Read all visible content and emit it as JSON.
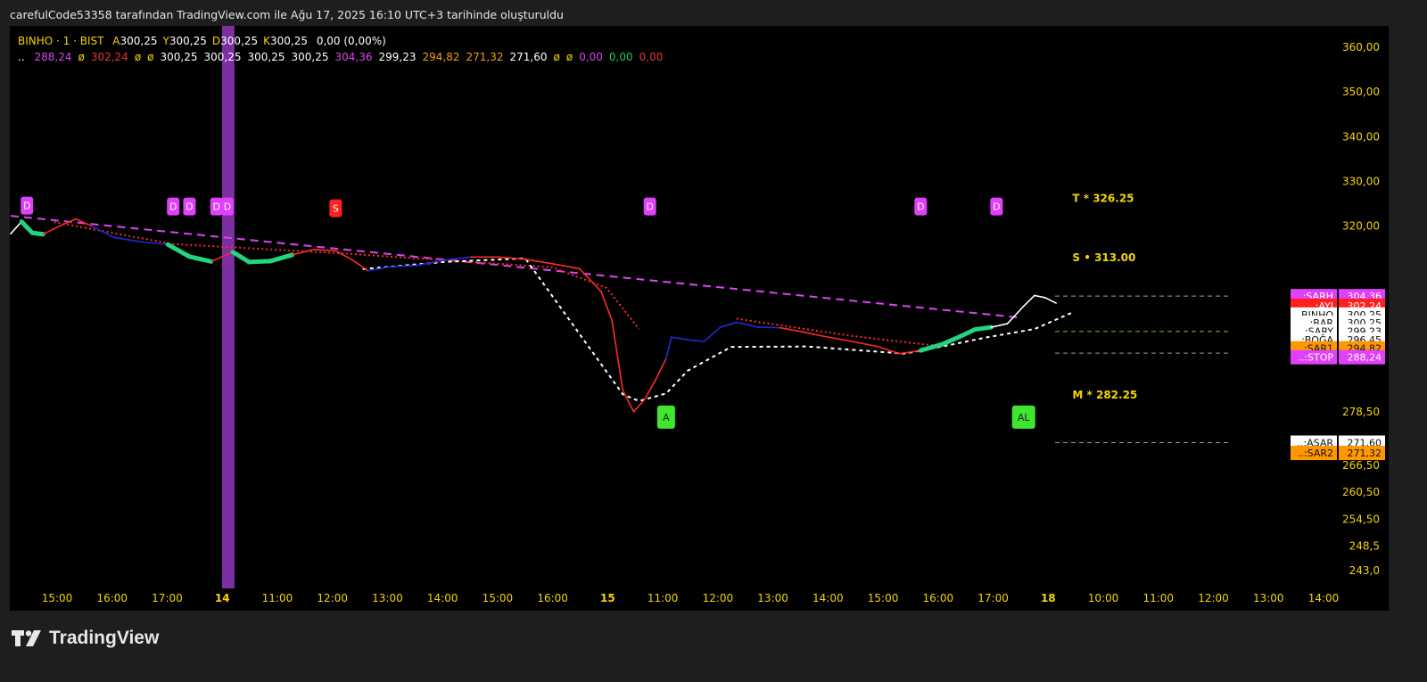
{
  "attribution": "carefulCode53358 tarafından TradingView.com ile Ağu 17, 2025 16:10 UTC+3 tarihinde oluşturuldu",
  "legend": {
    "symbol": "BINHO · 1 · BIST",
    "ohlc": [
      {
        "key": "A",
        "value": "300,25"
      },
      {
        "key": "Y",
        "value": "300,25"
      },
      {
        "key": "D",
        "value": "300,25"
      },
      {
        "key": "K",
        "value": "300,25"
      }
    ],
    "change": "0,00 (0,00%)",
    "indicator_prefix": "..",
    "indicator_values": [
      {
        "text": "288,24",
        "color": "#d946ef"
      },
      {
        "text": "ø",
        "color": "#f5d400"
      },
      {
        "text": "302,24",
        "color": "#e53935"
      },
      {
        "text": "ø",
        "color": "#f5d400"
      },
      {
        "text": "ø",
        "color": "#f5d400"
      },
      {
        "text": "300,25",
        "color": "#ffffff"
      },
      {
        "text": "300,25",
        "color": "#ffffff"
      },
      {
        "text": "300,25",
        "color": "#ffffff"
      },
      {
        "text": "300,25",
        "color": "#ffffff"
      },
      {
        "text": "304,36",
        "color": "#d946ef"
      },
      {
        "text": "299,23",
        "color": "#ffffff"
      },
      {
        "text": "294,82",
        "color": "#f59e0b"
      },
      {
        "text": "271,32",
        "color": "#f59e0b"
      },
      {
        "text": "271,60",
        "color": "#ffffff"
      },
      {
        "text": "ø",
        "color": "#f5d400"
      },
      {
        "text": "ø",
        "color": "#f5d400"
      },
      {
        "text": "0,00",
        "color": "#d946ef"
      },
      {
        "text": "0,00",
        "color": "#22c55e"
      },
      {
        "text": "0,00",
        "color": "#e53935"
      }
    ]
  },
  "footer": {
    "brand": "TradingView"
  },
  "chart_data": {
    "type": "line",
    "symbol": "BINHO",
    "timeframe": "1",
    "exchange": "BIST",
    "price_axis": {
      "ticks": [
        {
          "label": "360,00",
          "value": 360.0
        },
        {
          "label": "350,00",
          "value": 350.0
        },
        {
          "label": "340,00",
          "value": 340.0
        },
        {
          "label": "330,00",
          "value": 330.0
        },
        {
          "label": "320,00",
          "value": 320.0
        },
        {
          "label": "278,50",
          "value": 278.5
        },
        {
          "label": "266,50",
          "value": 266.5
        },
        {
          "label": "260,50",
          "value": 260.5
        },
        {
          "label": "254,50",
          "value": 254.5
        },
        {
          "label": "248,5",
          "value": 248.5
        },
        {
          "label": "243,0",
          "value": 243.0
        }
      ],
      "range": [
        239.8,
        364.9
      ]
    },
    "time_axis": {
      "labels": [
        {
          "label": "15:00",
          "bold": false
        },
        {
          "label": "16:00",
          "bold": false
        },
        {
          "label": "17:00",
          "bold": false
        },
        {
          "label": "14",
          "bold": true
        },
        {
          "label": "11:00",
          "bold": false
        },
        {
          "label": "12:00",
          "bold": false
        },
        {
          "label": "13:00",
          "bold": false
        },
        {
          "label": "14:00",
          "bold": false
        },
        {
          "label": "15:00",
          "bold": false
        },
        {
          "label": "16:00",
          "bold": false
        },
        {
          "label": "15",
          "bold": true
        },
        {
          "label": "11:00",
          "bold": false
        },
        {
          "label": "12:00",
          "bold": false
        },
        {
          "label": "13:00",
          "bold": false
        },
        {
          "label": "14:00",
          "bold": false
        },
        {
          "label": "15:00",
          "bold": false
        },
        {
          "label": "16:00",
          "bold": false
        },
        {
          "label": "17:00",
          "bold": false
        },
        {
          "label": "18",
          "bold": true
        },
        {
          "label": "10:00",
          "bold": false
        },
        {
          "label": "11:00",
          "bold": false
        },
        {
          "label": "12:00",
          "bold": false
        },
        {
          "label": "13:00",
          "bold": false
        },
        {
          "label": "14:00",
          "bold": false
        }
      ]
    },
    "price_series": [
      {
        "i": 0,
        "v": 318.3,
        "c": "white"
      },
      {
        "i": 2,
        "v": 321.0,
        "c": "white"
      },
      {
        "i": 4,
        "v": 318.5,
        "c": "green"
      },
      {
        "i": 6,
        "v": 318.2,
        "c": "green"
      },
      {
        "i": 9,
        "v": 320.0,
        "c": "red"
      },
      {
        "i": 12,
        "v": 321.6,
        "c": "red"
      },
      {
        "i": 15,
        "v": 320.0,
        "c": "red"
      },
      {
        "i": 19,
        "v": 317.5,
        "c": "blue"
      },
      {
        "i": 24,
        "v": 316.5,
        "c": "blue"
      },
      {
        "i": 29,
        "v": 315.9,
        "c": "blue"
      },
      {
        "i": 33,
        "v": 313.2,
        "c": "green"
      },
      {
        "i": 37,
        "v": 312.1,
        "c": "green"
      },
      {
        "i": 41,
        "v": 314.2,
        "c": "red"
      },
      {
        "i": 44,
        "v": 312.0,
        "c": "green"
      },
      {
        "i": 48,
        "v": 312.2,
        "c": "green"
      },
      {
        "i": 52,
        "v": 313.6,
        "c": "green"
      },
      {
        "i": 56,
        "v": 314.8,
        "c": "red"
      },
      {
        "i": 60,
        "v": 314.5,
        "c": "red"
      },
      {
        "i": 63,
        "v": 312.5,
        "c": "red"
      },
      {
        "i": 66,
        "v": 310.0,
        "c": "red"
      },
      {
        "i": 70,
        "v": 310.9,
        "c": "blue"
      },
      {
        "i": 75,
        "v": 311.2,
        "c": "blue"
      },
      {
        "i": 80,
        "v": 312.4,
        "c": "blue"
      },
      {
        "i": 85,
        "v": 313.1,
        "c": "blue"
      },
      {
        "i": 90,
        "v": 313.1,
        "c": "red"
      },
      {
        "i": 95,
        "v": 312.6,
        "c": "red"
      },
      {
        "i": 100,
        "v": 311.6,
        "c": "red"
      },
      {
        "i": 105,
        "v": 310.5,
        "c": "red"
      },
      {
        "i": 109,
        "v": 305.4,
        "c": "red"
      },
      {
        "i": 111,
        "v": 298.9,
        "c": "red"
      },
      {
        "i": 113,
        "v": 283.3,
        "c": "red"
      },
      {
        "i": 115,
        "v": 278.5,
        "c": "red"
      },
      {
        "i": 117,
        "v": 281.2,
        "c": "red"
      },
      {
        "i": 119,
        "v": 285.5,
        "c": "red"
      },
      {
        "i": 121,
        "v": 290.4,
        "c": "red"
      },
      {
        "i": 122,
        "v": 295.2,
        "c": "blue"
      },
      {
        "i": 125,
        "v": 294.6,
        "c": "blue"
      },
      {
        "i": 128,
        "v": 294.2,
        "c": "blue"
      },
      {
        "i": 131,
        "v": 297.4,
        "c": "blue"
      },
      {
        "i": 134,
        "v": 298.5,
        "c": "blue"
      },
      {
        "i": 138,
        "v": 297.4,
        "c": "blue"
      },
      {
        "i": 142,
        "v": 297.3,
        "c": "blue"
      },
      {
        "i": 146,
        "v": 296.4,
        "c": "red"
      },
      {
        "i": 150,
        "v": 295.4,
        "c": "red"
      },
      {
        "i": 155,
        "v": 294.3,
        "c": "red"
      },
      {
        "i": 160,
        "v": 293.1,
        "c": "red"
      },
      {
        "i": 164,
        "v": 291.5,
        "c": "red"
      },
      {
        "i": 168,
        "v": 292.2,
        "c": "red"
      },
      {
        "i": 172,
        "v": 293.6,
        "c": "green"
      },
      {
        "i": 175,
        "v": 295.2,
        "c": "green"
      },
      {
        "i": 178,
        "v": 296.9,
        "c": "green"
      },
      {
        "i": 181,
        "v": 297.4,
        "c": "green"
      },
      {
        "i": 184,
        "v": 298.2,
        "c": "white"
      },
      {
        "i": 187,
        "v": 302.1,
        "c": "white"
      },
      {
        "i": 189,
        "v": 304.5,
        "c": "white"
      },
      {
        "i": 191,
        "v": 304.0,
        "c": "white"
      },
      {
        "i": 193,
        "v": 302.8,
        "c": "white"
      }
    ],
    "index_span": [
      0,
      245
    ],
    "purple_trend_line": {
      "from": {
        "i": 0,
        "v": 322.3
      },
      "to": {
        "i": 186,
        "v": 299.6
      },
      "color": "#d946ef",
      "dashed": true
    },
    "red_dotted_line": [
      {
        "i": 8,
        "v": 320.9
      },
      {
        "i": 30,
        "v": 316.0
      },
      {
        "i": 60,
        "v": 314.0
      },
      {
        "i": 85,
        "v": 312.0
      },
      {
        "i": 100,
        "v": 310.8
      },
      {
        "i": 110,
        "v": 306.2
      },
      {
        "i": 116,
        "v": 297.0
      }
    ],
    "red_dotted_line_2": [
      {
        "i": 134,
        "v": 299.3
      },
      {
        "i": 155,
        "v": 295.5
      },
      {
        "i": 172,
        "v": 293.1
      }
    ],
    "white_dashed_line": [
      {
        "i": 65,
        "v": 310.4
      },
      {
        "i": 80,
        "v": 312.0
      },
      {
        "i": 95,
        "v": 312.8
      },
      {
        "i": 113,
        "v": 282.4
      },
      {
        "i": 116,
        "v": 280.9
      },
      {
        "i": 121,
        "v": 282.6
      },
      {
        "i": 125,
        "v": 287.7
      },
      {
        "i": 133,
        "v": 293.0
      },
      {
        "i": 147,
        "v": 293.1
      },
      {
        "i": 165,
        "v": 291.5
      },
      {
        "i": 172,
        "v": 293.1
      },
      {
        "i": 180,
        "v": 295.1
      },
      {
        "i": 189,
        "v": 297.0
      },
      {
        "i": 196,
        "v": 300.7
      }
    ],
    "signal_markers": [
      {
        "i": 3,
        "v": 324.6,
        "text": "D",
        "type": "D"
      },
      {
        "i": 30,
        "v": 324.4,
        "text": "D",
        "type": "D"
      },
      {
        "i": 33,
        "v": 324.4,
        "text": "D",
        "type": "D"
      },
      {
        "i": 38,
        "v": 324.4,
        "text": "D",
        "type": "D"
      },
      {
        "i": 40,
        "v": 324.4,
        "text": "D",
        "type": "D"
      },
      {
        "i": 60,
        "v": 324.0,
        "text": "S",
        "type": "S"
      },
      {
        "i": 118,
        "v": 324.4,
        "text": "D",
        "type": "D"
      },
      {
        "i": 168,
        "v": 324.4,
        "text": "D",
        "type": "D"
      },
      {
        "i": 182,
        "v": 324.4,
        "text": "D",
        "type": "D"
      },
      {
        "i": 121,
        "v": 277.3,
        "text": "A",
        "type": "A"
      },
      {
        "i": 187,
        "v": 277.3,
        "text": "AL",
        "type": "A"
      }
    ],
    "vertical_highlight_index": 40,
    "targets": [
      {
        "label": "T * 326.25",
        "value": 326.25,
        "i": 196
      },
      {
        "label": "S • 313.00",
        "value": 313.0,
        "i": 196
      },
      {
        "label": "M * 282.25",
        "value": 282.25,
        "i": 196
      }
    ],
    "horizontal_levels": [
      {
        "value": 304.36,
        "color": "#9b9b9b"
      },
      {
        "value": 296.45,
        "color": "#6cc24a"
      },
      {
        "value": 291.6,
        "color": "#9b9b9b"
      },
      {
        "value": 271.6,
        "color": "#9b9b9b"
      }
    ],
    "axis_badges": [
      {
        "label": "..:SARH",
        "value": "304,36",
        "v": 304.36,
        "bg": "#e040fb",
        "fg": "#ffffff"
      },
      {
        "label": "..:AYI",
        "value": "302,24",
        "v": 302.24,
        "bg": "#ff1f1f",
        "fg": "#ffffff"
      },
      {
        "label": "BINHO",
        "value": "300,25",
        "v": 300.25,
        "bg": "#ffffff",
        "fg": "#111111"
      },
      {
        "label": "..:BAR",
        "value": "300,25",
        "v": 298.4,
        "bg": "#ffffff",
        "fg": "#111111"
      },
      {
        "label": "..:SARY",
        "value": "299,23",
        "v": 296.5,
        "bg": "#ffffff",
        "fg": "#111111"
      },
      {
        "label": "..:BOĞA",
        "value": "296,45",
        "v": 294.6,
        "bg": "#ffffff",
        "fg": "#111111"
      },
      {
        "label": "..:SAR1",
        "value": "294,82",
        "v": 292.7,
        "bg": "#ff9800",
        "fg": "#111111"
      },
      {
        "label": "..:STOP",
        "value": "288,24",
        "v": 290.7,
        "bg": "#e040fb",
        "fg": "#ffffff"
      },
      {
        "label": "..:ASAR",
        "value": "271,60",
        "v": 271.6,
        "bg": "#ffffff",
        "fg": "#111111"
      },
      {
        "label": "..:SAR2",
        "value": "271,32",
        "v": 269.3,
        "bg": "#ff9800",
        "fg": "#111111"
      }
    ],
    "colors": {
      "up": "#22d67f",
      "down": "#ff2a2a",
      "neutral": "#1f2ad6",
      "last": "#ffffff",
      "axis_text": "#f5d400",
      "target_text": "#f5d400",
      "highlight": "#7b2fa0"
    }
  }
}
